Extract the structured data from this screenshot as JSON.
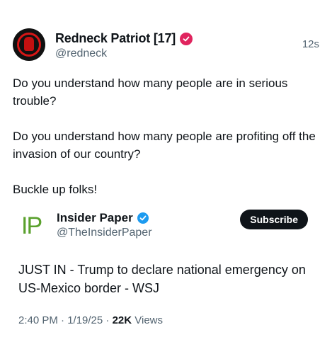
{
  "post": {
    "author_name": "Redneck Patriot [17]",
    "handle": "@redneck",
    "time": "12s",
    "paragraphs": [
      "Do you understand how many people are in serious trouble?",
      "Do you understand how many people are profiting off the invasion of our country?",
      "Buckle up folks!"
    ]
  },
  "quote": {
    "logo_text": "IP",
    "author_name": "Insider Paper",
    "handle": "@TheInsiderPaper",
    "subscribe_label": "Subscribe",
    "text": "JUST IN - Trump to declare national emergency on US-Mexico border - WSJ",
    "timestamp": "2:40 PM · 1/19/25 · ",
    "views_count": "22K",
    "views_label": " Views"
  },
  "colors": {
    "verified_pink": "#e0245e",
    "verified_blue": "#1d9bf0",
    "logo_green": "#5aa12d"
  },
  "icons": [
    "avatar-image",
    "verified-badge-icon",
    "verified-check-icon",
    "insider-paper-logo"
  ]
}
